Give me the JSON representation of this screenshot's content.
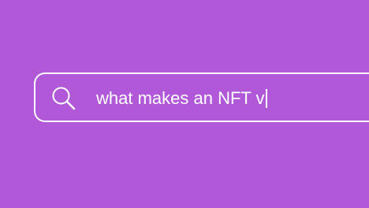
{
  "search": {
    "query": "what makes an NFT v",
    "icon": "search-icon"
  },
  "colors": {
    "background": "#b058d8",
    "foreground": "#ffffff"
  }
}
